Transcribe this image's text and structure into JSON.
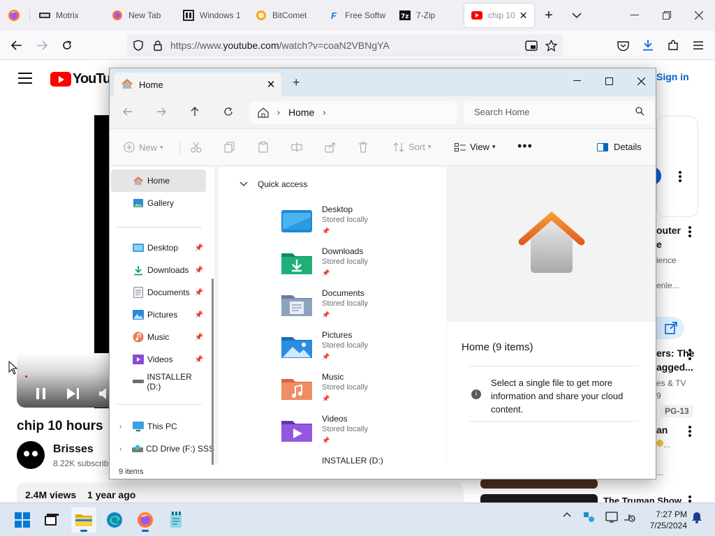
{
  "browser": {
    "tabs": [
      {
        "label": "Motrix",
        "icon": "motrix-icon"
      },
      {
        "label": "New Tab",
        "icon": "firefox-icon"
      },
      {
        "label": "Windows 1",
        "icon": "windows-site-icon"
      },
      {
        "label": "BitComet",
        "icon": "bitcomet-icon"
      },
      {
        "label": "Free Softw",
        "icon": "free-software-icon"
      },
      {
        "label": "7-Zip",
        "icon": "7zip-icon"
      },
      {
        "label": "chip 10 ",
        "icon": "youtube-icon"
      }
    ],
    "url_prefix": "https://www.",
    "url_domain": "youtube.com",
    "url_path": "/watch?v=coaN2VBNgYA"
  },
  "youtube": {
    "logo_text": "YouTube",
    "sign_in": "Sign in",
    "video_title": "chip 10 hours",
    "channel": "Brisses",
    "subscribers": "8.22K subscrib",
    "views": "2.4M views",
    "age": "1 year ago",
    "sidebar": [
      {
        "title": "outer",
        "title2": "e",
        "sub": "ience",
        "sub2": "enle..."
      },
      {
        "title": "ers: The",
        "title2": "agged...",
        "sub": "es & TV",
        "sub2": "9",
        "badge": "PG-13"
      },
      {
        "title": "an",
        "sub2": "..."
      },
      {
        "title": "The Truman Show"
      }
    ]
  },
  "explorer": {
    "tab_title": "Home",
    "breadcrumb": "Home",
    "search_placeholder": "Search Home",
    "commands": {
      "new": "New",
      "sort": "Sort",
      "view": "View",
      "details": "Details"
    },
    "nav_items": [
      {
        "label": "Home",
        "icon": "home-icon"
      },
      {
        "label": "Gallery",
        "icon": "gallery-icon"
      },
      {
        "label": "Desktop",
        "icon": "desktop-folder-icon"
      },
      {
        "label": "Downloads",
        "icon": "downloads-folder-icon"
      },
      {
        "label": "Documents",
        "icon": "documents-folder-icon"
      },
      {
        "label": "Pictures",
        "icon": "pictures-folder-icon"
      },
      {
        "label": "Music",
        "icon": "music-folder-icon"
      },
      {
        "label": "Videos",
        "icon": "videos-folder-icon"
      },
      {
        "label": "INSTALLER (D:)",
        "icon": "drive-icon"
      },
      {
        "label": "This PC",
        "icon": "this-pc-icon"
      },
      {
        "label": "CD Drive (F:) SSS",
        "icon": "cd-drive-icon"
      }
    ],
    "quick_access_label": "Quick access",
    "quick_access": [
      {
        "name": "Desktop",
        "status": "Stored locally"
      },
      {
        "name": "Downloads",
        "status": "Stored locally"
      },
      {
        "name": "Documents",
        "status": "Stored locally"
      },
      {
        "name": "Pictures",
        "status": "Stored locally"
      },
      {
        "name": "Music",
        "status": "Stored locally"
      },
      {
        "name": "Videos",
        "status": "Stored locally"
      },
      {
        "name": "INSTALLER (D:)",
        "status": ""
      }
    ],
    "details_title": "Home (9 items)",
    "details_info": "Select a single file to get more information and share your cloud content.",
    "status": "9 items"
  },
  "taskbar": {
    "time": "7:27 PM",
    "date": "7/25/2024"
  },
  "colors": {
    "youtube_red": "#ff0000",
    "link_blue": "#065fd4",
    "accent": "#0067c0"
  }
}
